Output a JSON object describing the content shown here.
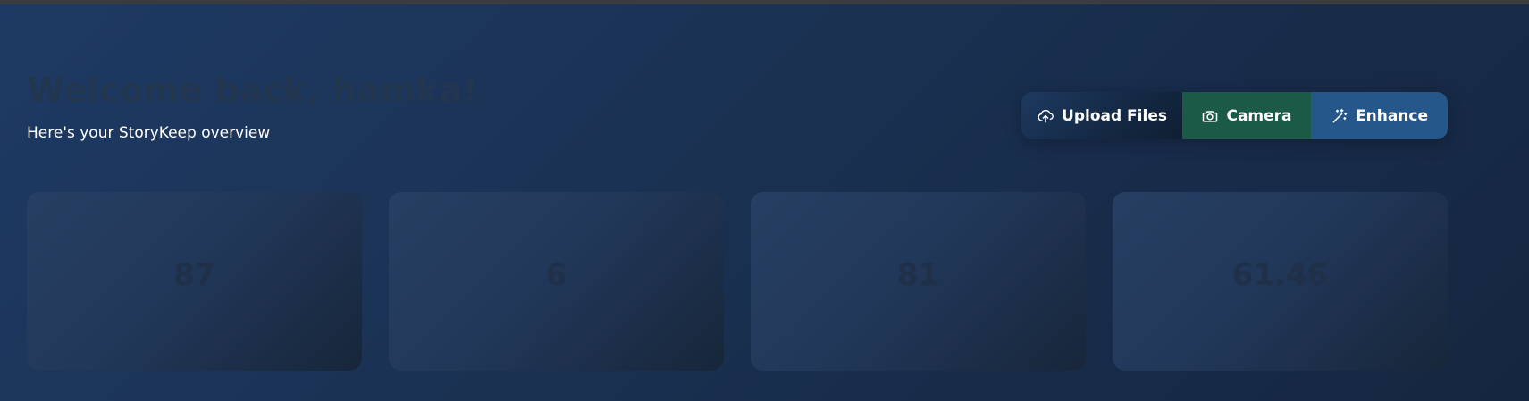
{
  "header": {
    "welcome": "Welcome back, hamka!",
    "subtitle": "Here's your StoryKeep overview"
  },
  "actions": {
    "upload": {
      "label": "Upload Files",
      "icon": "cloud-upload-icon"
    },
    "camera": {
      "label": "Camera",
      "icon": "camera-icon"
    },
    "enhance": {
      "label": "Enhance",
      "icon": "magic-wand-icon"
    }
  },
  "stats": [
    {
      "value": "87",
      "label": ""
    },
    {
      "value": "6",
      "label": ""
    },
    {
      "value": "81",
      "label": ""
    },
    {
      "value": "61.46",
      "label": ""
    }
  ],
  "colors": {
    "camera": "#1c5a48",
    "enhance": "#25578a",
    "upload": "#142843"
  }
}
